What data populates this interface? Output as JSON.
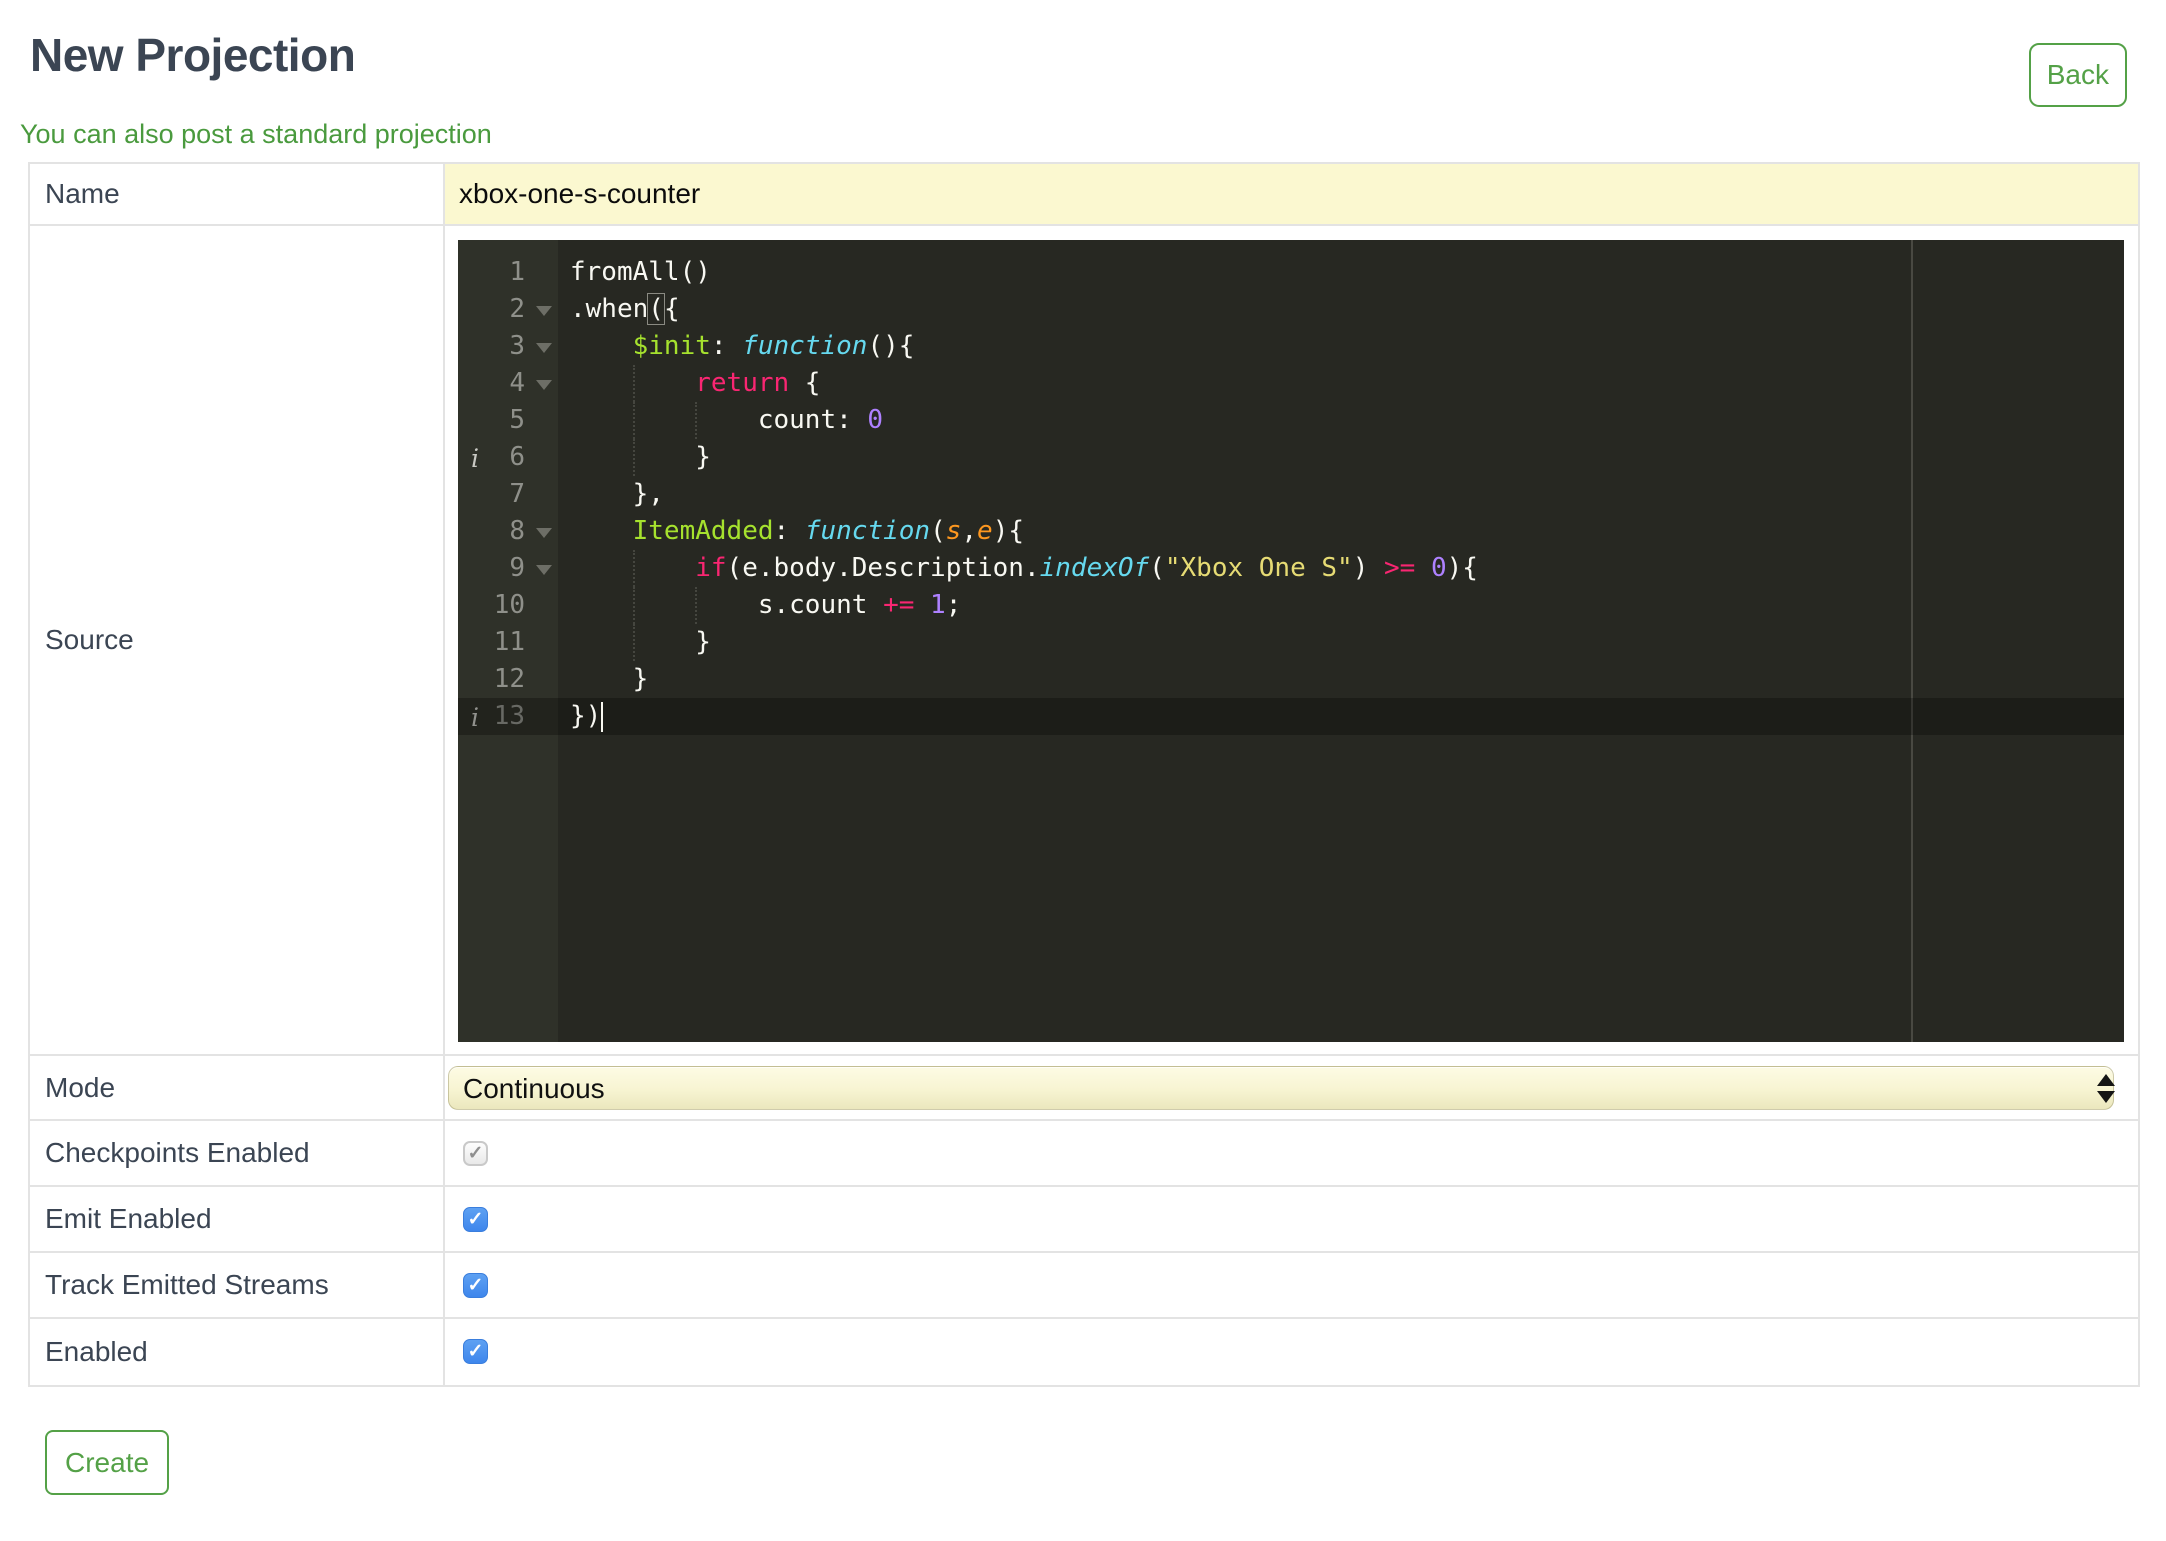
{
  "page": {
    "title": "New Projection",
    "back_label": "Back",
    "standard_link": "You can also post a standard projection",
    "create_label": "Create"
  },
  "form": {
    "name_label": "Name",
    "name_value": "xbox-one-s-counter",
    "source_label": "Source",
    "mode_label": "Mode",
    "mode_value": "Continuous",
    "checkbox_rows": [
      {
        "label": "Checkpoints Enabled",
        "checked": true,
        "disabled": true
      },
      {
        "label": "Emit Enabled",
        "checked": true,
        "disabled": false
      },
      {
        "label": "Track Emitted Streams",
        "checked": true,
        "disabled": false
      },
      {
        "label": "Enabled",
        "checked": true,
        "disabled": false
      }
    ]
  },
  "editor": {
    "theme": "monokai",
    "active_line": 13,
    "cursor": {
      "line": 13,
      "col": 2
    },
    "annotation_lines": [
      6,
      13
    ],
    "fold_lines": [
      2,
      3,
      4,
      8,
      9
    ],
    "colors": {
      "bg": "#272822",
      "gutter_bg": "#2f3129",
      "gutter_fg": "#8f908a",
      "plain": "#f8f8f2",
      "keyword": "#f92672",
      "function": "#66d9ef",
      "entity": "#a6e22e",
      "number": "#ae81ff",
      "string": "#e6db74",
      "param": "#fd971f"
    },
    "lines": [
      {
        "num": 1,
        "tokens": [
          [
            "fromAll()",
            "pl"
          ]
        ]
      },
      {
        "num": 2,
        "tokens": [
          [
            ".when",
            "pl"
          ],
          [
            "(",
            "pl match"
          ],
          [
            "{",
            "pl"
          ]
        ]
      },
      {
        "num": 3,
        "tokens": [
          [
            "    ",
            "pl"
          ],
          [
            "$init",
            "ent"
          ],
          [
            ": ",
            "pl"
          ],
          [
            "function",
            "fn"
          ],
          [
            "(){",
            "pl"
          ]
        ]
      },
      {
        "num": 4,
        "tokens": [
          [
            "        ",
            "pl"
          ],
          [
            "return",
            "kw"
          ],
          [
            " {",
            "pl"
          ]
        ]
      },
      {
        "num": 5,
        "tokens": [
          [
            "            count: ",
            "pl"
          ],
          [
            "0",
            "num"
          ]
        ]
      },
      {
        "num": 6,
        "tokens": [
          [
            "        }",
            "pl"
          ]
        ]
      },
      {
        "num": 7,
        "tokens": [
          [
            "    },",
            "pl"
          ]
        ]
      },
      {
        "num": 8,
        "tokens": [
          [
            "    ",
            "pl"
          ],
          [
            "ItemAdded",
            "ent"
          ],
          [
            ": ",
            "pl"
          ],
          [
            "function",
            "fn"
          ],
          [
            "(",
            "pl"
          ],
          [
            "s",
            "param"
          ],
          [
            ",",
            "pl"
          ],
          [
            "e",
            "param"
          ],
          [
            "){",
            "pl"
          ]
        ]
      },
      {
        "num": 9,
        "tokens": [
          [
            "        ",
            "pl"
          ],
          [
            "if",
            "kw"
          ],
          [
            "(e.body.Description.",
            "pl"
          ],
          [
            "indexOf",
            "fn"
          ],
          [
            "(",
            "pl"
          ],
          [
            "\"Xbox One S\"",
            "str"
          ],
          [
            ") ",
            "pl"
          ],
          [
            ">=",
            "kw"
          ],
          [
            " ",
            "pl"
          ],
          [
            "0",
            "num"
          ],
          [
            "){",
            "pl"
          ]
        ]
      },
      {
        "num": 10,
        "tokens": [
          [
            "            s.count ",
            "pl"
          ],
          [
            "+=",
            "kw"
          ],
          [
            " ",
            "pl"
          ],
          [
            "1",
            "num"
          ],
          [
            ";",
            "pl"
          ]
        ]
      },
      {
        "num": 11,
        "tokens": [
          [
            "        }",
            "pl"
          ]
        ]
      },
      {
        "num": 12,
        "tokens": [
          [
            "    }",
            "pl"
          ]
        ]
      },
      {
        "num": 13,
        "tokens": [
          [
            "})",
            "pl"
          ]
        ]
      }
    ]
  },
  "colors": {
    "accent_green": "#54a147",
    "heading": "#3b4553",
    "row_border": "#e3e3e3",
    "input_yellow": "#fbf8d0",
    "checkbox_blue": "#4a90ee"
  }
}
